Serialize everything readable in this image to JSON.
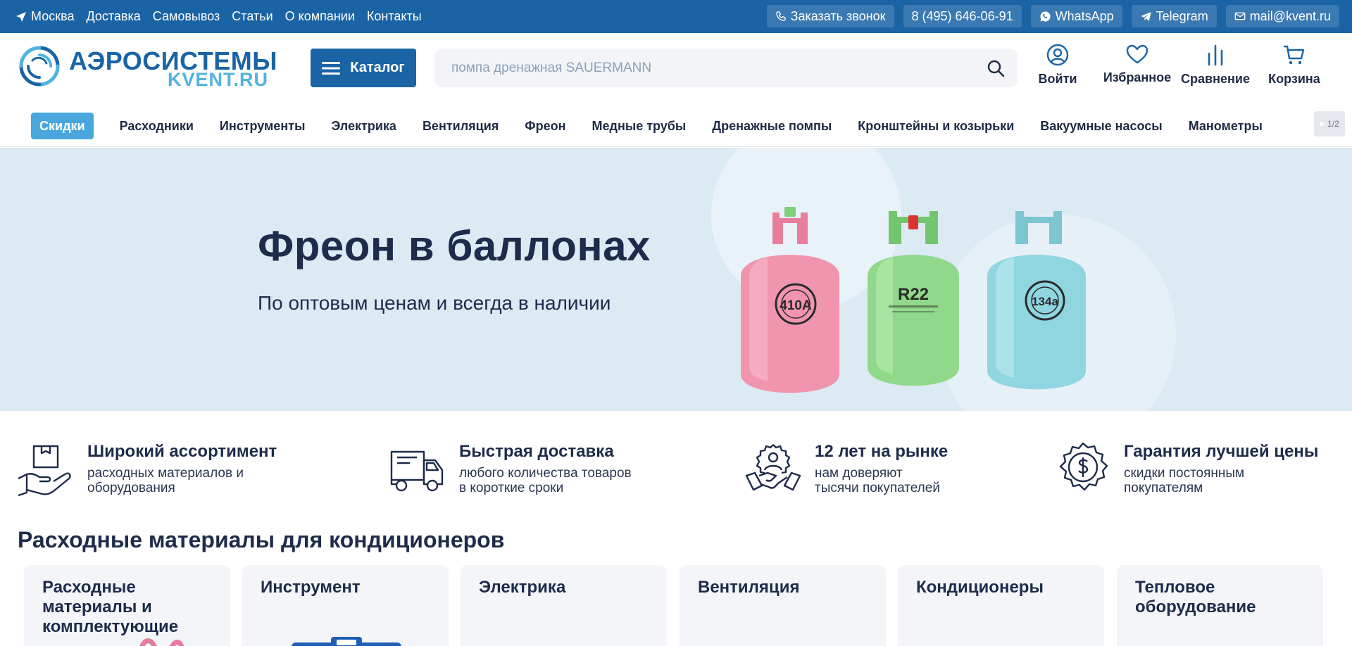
{
  "topbar": {
    "city": "Москва",
    "links": [
      "Доставка",
      "Самовывоз",
      "Статьи",
      "О компании",
      "Контакты"
    ],
    "callback": "Заказать звонок",
    "phone": "8 (495) 646-06-91",
    "whatsapp": "WhatsApp",
    "telegram": "Telegram",
    "email": "mail@kvent.ru"
  },
  "header": {
    "logo_top": "АЭРОСИСТЕМЫ",
    "logo_bottom": "KVENT.RU",
    "catalog": "Каталог",
    "search_placeholder": "помпа дренажная SAUERMANN",
    "login": "Войти",
    "favorites": "Избранное",
    "compare": "Сравнение",
    "cart": "Корзина"
  },
  "nav": {
    "discount": "Скидки",
    "items": [
      "Расходники",
      "Инструменты",
      "Электрика",
      "Вентиляция",
      "Фреон",
      "Медные трубы",
      "Дренажные помпы",
      "Кронштейны и козырьки",
      "Вакуумные насосы",
      "Манометры"
    ],
    "pager": "1/2"
  },
  "banner": {
    "title": "Фреон в баллонах",
    "subtitle": "По оптовым ценам и всегда в наличии",
    "cylinders": [
      {
        "label": "410A",
        "color": "#ef8fa8"
      },
      {
        "label": "R22",
        "color": "#8fd68a"
      },
      {
        "label": "134a",
        "color": "#8ad4df"
      }
    ]
  },
  "features": [
    {
      "title": "Широкий ассортимент",
      "line1": "расходных материалов и",
      "line2": "оборудования",
      "icon": "hand-box-icon"
    },
    {
      "title": "Быстрая доставка",
      "line1": "любого количества товаров",
      "line2": "в короткие сроки",
      "icon": "truck-icon"
    },
    {
      "title": "12 лет на рынке",
      "line1": "нам доверяют",
      "line2": "тысячи покупателей",
      "icon": "handshake-icon"
    },
    {
      "title": "Гарантия лучшей цены",
      "line1": "скидки постоянным",
      "line2": "покупателям",
      "icon": "dollar-badge-icon"
    }
  ],
  "section": {
    "title": "Расходные материалы для кондиционеров",
    "cards": [
      "Расходные материалы и комплектующие",
      "Инструмент",
      "Электрика",
      "Вентиляция",
      "Кондиционеры",
      "Тепловое оборудование"
    ]
  },
  "colors": {
    "brand": "#1a64a6",
    "accent": "#4aa7dd",
    "text": "#1e2b4a"
  }
}
